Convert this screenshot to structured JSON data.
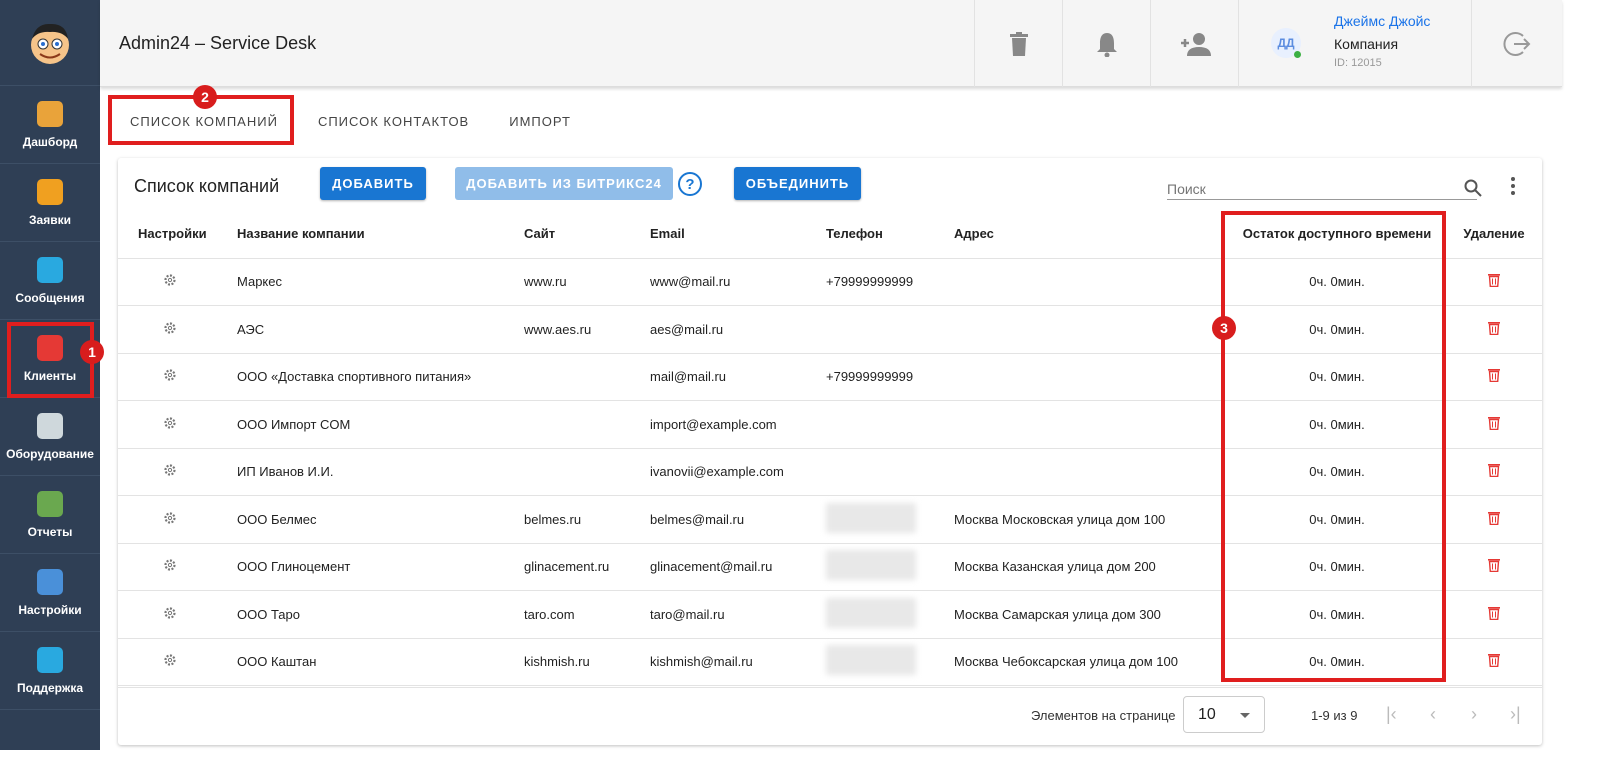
{
  "app": {
    "title": "Admin24 – Service Desk"
  },
  "sidebar": {
    "items": [
      {
        "label": "Дашборд",
        "color": "#e9a33a"
      },
      {
        "label": "Заявки",
        "color": "#f0a020"
      },
      {
        "label": "Сообщения",
        "color": "#29a9e0"
      },
      {
        "label": "Клиенты",
        "color": "#e53935"
      },
      {
        "label": "Оборудование",
        "color": "#cfd8dc"
      },
      {
        "label": "Отчеты",
        "color": "#6aa84f"
      },
      {
        "label": "Настройки",
        "color": "#4a90d9"
      },
      {
        "label": "Поддержка",
        "color": "#29a9e0"
      }
    ]
  },
  "user": {
    "initials": "ДД",
    "name": "Джеймс Джойс",
    "company": "Компания",
    "id": "ID: 12015"
  },
  "tabs": [
    "СПИСОК КОМПАНИЙ",
    "СПИСОК КОНТАКТОВ",
    "ИМПОРТ"
  ],
  "card": {
    "title": "Список компаний",
    "add": "ДОБАВИТЬ",
    "add_bitrix": "ДОБАВИТЬ ИЗ БИТРИКС24",
    "merge": "ОБЪЕДИНИТЬ",
    "search_placeholder": "Поиск"
  },
  "columns": [
    "Настройки",
    "Название компании",
    "Сайт",
    "Email",
    "Телефон",
    "Адрес",
    "Остаток доступного времени",
    "Удаление"
  ],
  "rows": [
    {
      "name": "Маркес",
      "site": "www.ru",
      "email": "www@mail.ru",
      "phone": "+79999999999",
      "address": "",
      "time": "0ч. 0мин."
    },
    {
      "name": "АЭС",
      "site": "www.aes.ru",
      "email": "aes@mail.ru",
      "phone": "",
      "address": "",
      "time": "0ч. 0мин."
    },
    {
      "name": "ООО «Доставка спортивного питания»",
      "site": "",
      "email": "mail@mail.ru",
      "phone": "+79999999999",
      "address": "",
      "time": "0ч. 0мин."
    },
    {
      "name": "ООО Импорт COM",
      "site": "",
      "email": "import@example.com",
      "phone": "",
      "address": "",
      "time": "0ч. 0мин."
    },
    {
      "name": "ИП Иванов И.И.",
      "site": "",
      "email": "ivanovii@example.com",
      "phone": "",
      "address": "",
      "time": "0ч. 0мин."
    },
    {
      "name": "ООО Белмес",
      "site": "belmes.ru",
      "email": "belmes@mail.ru",
      "phone": "",
      "address": "Москва Московская улица дом 100",
      "time": "0ч. 0мин."
    },
    {
      "name": "ООО Глиноцемент",
      "site": "glinacement.ru",
      "email": "glinacement@mail.ru",
      "phone": "",
      "address": "Москва Казанская улица дом 200",
      "time": "0ч. 0мин."
    },
    {
      "name": "ООО Таро",
      "site": "taro.com",
      "email": "taro@mail.ru",
      "phone": "",
      "address": "Москва Самарская улица дом 300",
      "time": "0ч. 0мин."
    },
    {
      "name": "ООО Каштан",
      "site": "kishmish.ru",
      "email": "kishmish@mail.ru",
      "phone": "",
      "address": "Москва Чебоксарская улица дом 100",
      "time": "0ч. 0мин."
    }
  ],
  "pagination": {
    "label": "Элементов на странице",
    "per_page": "10",
    "range": "1-9 из 9"
  },
  "annotations": [
    "1",
    "2",
    "3"
  ]
}
